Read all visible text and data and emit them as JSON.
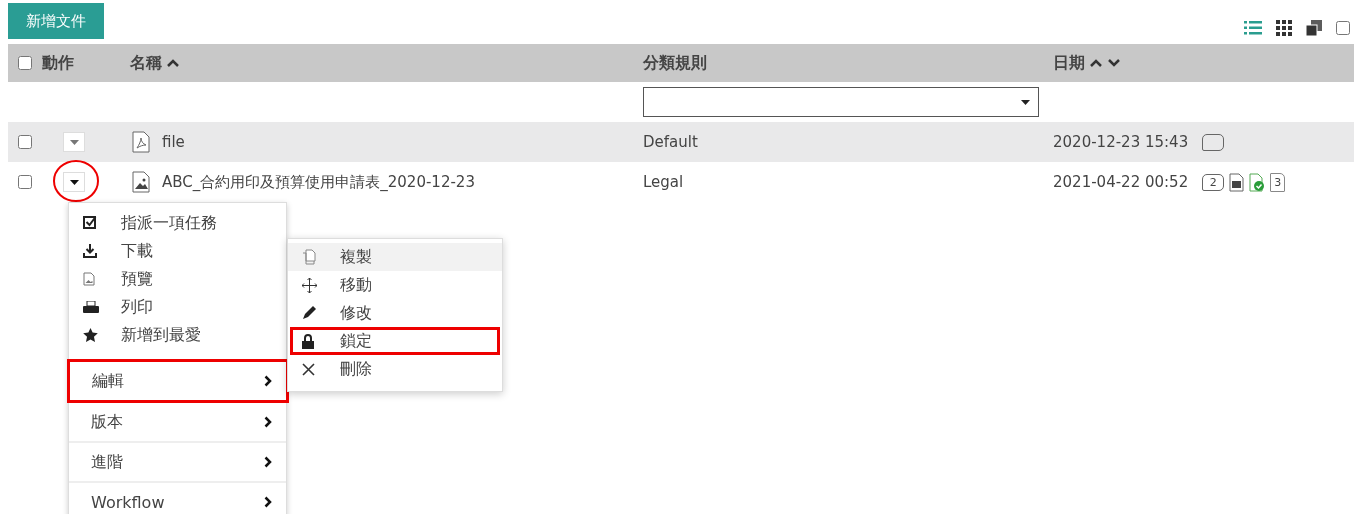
{
  "toolbar": {
    "add_button": "新增文件",
    "views": [
      {
        "kind": "list",
        "selected": true
      },
      {
        "kind": "grid",
        "selected": false
      },
      {
        "kind": "stack",
        "selected": false
      }
    ],
    "select_all_checked": false
  },
  "table": {
    "columns": [
      {
        "label": "動作",
        "sort_up": false,
        "sort_down": false
      },
      {
        "label": "名稱",
        "sort_up": true,
        "sort_down": false
      },
      {
        "label": "分類規則",
        "sort_up": false,
        "sort_down": false
      },
      {
        "label": "日期",
        "sort_up": true,
        "sort_down": true
      }
    ],
    "header_checked": false,
    "rows": [
      {
        "checked": false,
        "kind": "pdf",
        "name": "file",
        "category": "Default",
        "date": "2020-12-23 15:43",
        "circled": false,
        "icons": [
          {
            "kind": "comment"
          }
        ]
      },
      {
        "checked": false,
        "kind": "image",
        "name": "ABC_合約用印及預算使用申請表_2020-12-23",
        "category": "Legal",
        "date": "2021-04-22 00:52",
        "circled": true,
        "icons": [
          {
            "kind": "comment",
            "count": "2"
          },
          {
            "kind": "document"
          },
          {
            "kind": "approved"
          },
          {
            "kind": "version",
            "count": "3"
          }
        ]
      }
    ]
  },
  "action_menu": {
    "items": [
      {
        "kind": "task",
        "label": "指派一項任務"
      },
      {
        "kind": "download",
        "label": "下載"
      },
      {
        "kind": "preview",
        "label": "預覽"
      },
      {
        "kind": "print",
        "label": "列印"
      },
      {
        "kind": "star",
        "label": "新增到最愛"
      }
    ],
    "submenus": [
      {
        "label": "編輯",
        "highlighted": true
      },
      {
        "label": "版本",
        "highlighted": false
      },
      {
        "label": "進階",
        "highlighted": false
      },
      {
        "label": "Workflow",
        "highlighted": false
      }
    ]
  },
  "edit_menu": {
    "items": [
      {
        "kind": "copy",
        "label": "複製",
        "hovered": true,
        "highlighted": false
      },
      {
        "kind": "move",
        "label": "移動",
        "hovered": false,
        "highlighted": false
      },
      {
        "kind": "edit",
        "label": "修改",
        "hovered": false,
        "highlighted": false
      },
      {
        "kind": "lock",
        "label": "鎖定",
        "hovered": false,
        "highlighted": true
      },
      {
        "kind": "delete",
        "label": "刪除",
        "hovered": false,
        "highlighted": false
      }
    ]
  }
}
